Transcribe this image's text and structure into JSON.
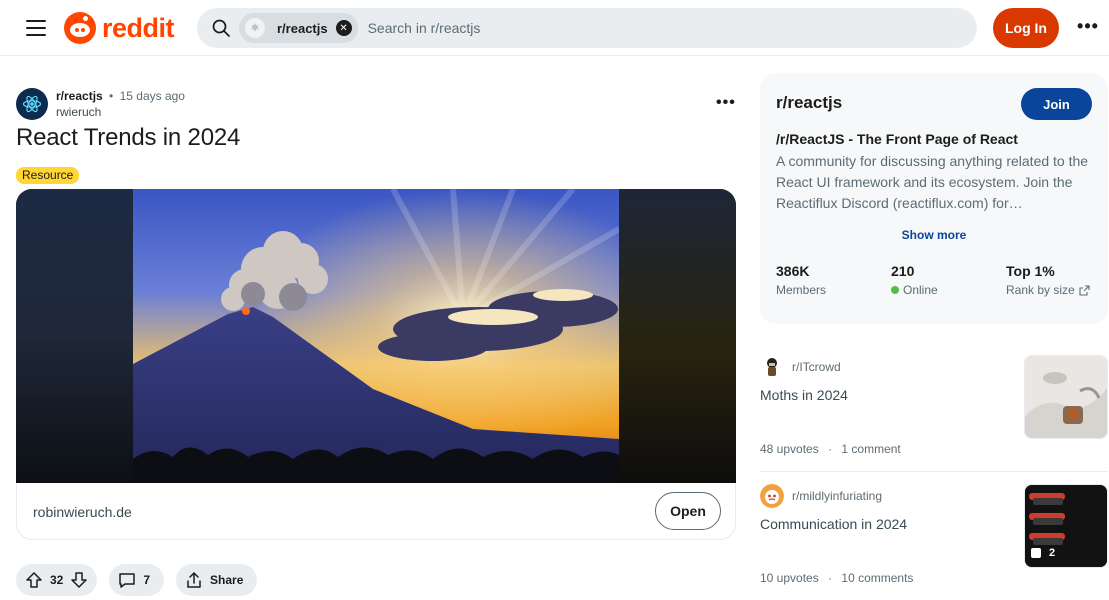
{
  "header": {
    "logo_text": "reddit",
    "search": {
      "chip_label": "r/reactjs",
      "placeholder": "Search in r/reactjs"
    },
    "login_label": "Log In",
    "more_label": "•••"
  },
  "post": {
    "subreddit": "r/reactjs",
    "separator": "•",
    "time": "15 days ago",
    "author": "rwieruch",
    "more_label": "•••",
    "title": "React Trends in 2024",
    "flair": "Resource",
    "link_domain": "robinwieruch.de",
    "open_label": "Open",
    "votes": "32",
    "comments": "7",
    "share_label": "Share"
  },
  "sidebar": {
    "name": "r/reactjs",
    "join_label": "Join",
    "title": "/r/ReactJS - The Front Page of React",
    "description": "A community for discussing anything related to the React UI framework and its ecosystem. Join the Reactiflux Discord (reactiflux.com) for…",
    "show_more": "Show more",
    "stats": [
      {
        "value": "386K",
        "label": "Members"
      },
      {
        "value": "210",
        "label": "Online"
      },
      {
        "value": "Top 1%",
        "label": "Rank by size"
      }
    ]
  },
  "related": [
    {
      "subreddit": "r/ITcrowd",
      "title": "Moths in 2024",
      "upvotes": "48 upvotes",
      "dot": "·",
      "comments": "1 comment"
    },
    {
      "subreddit": "r/mildlyinfuriating",
      "title": "Communication in 2024",
      "upvotes": "10 upvotes",
      "dot": "·",
      "comments": "10 comments",
      "thumb_count": "2"
    }
  ],
  "colors": {
    "brand": "#ff4500",
    "login": "#d93900",
    "join": "#0a449b",
    "flair": "#ffd635",
    "online": "#55bd46"
  }
}
